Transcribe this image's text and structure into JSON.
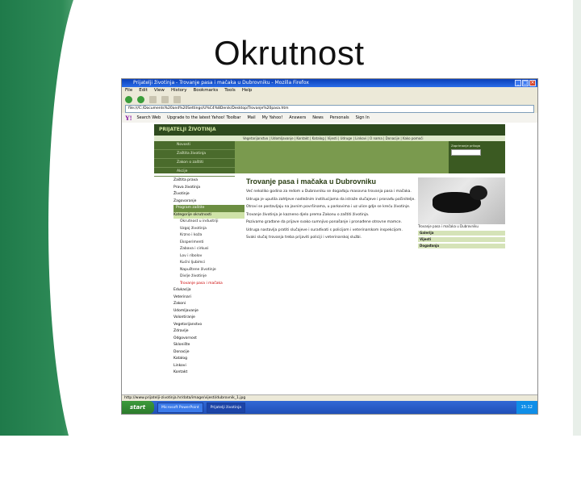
{
  "slide": {
    "title": "Okrutnost"
  },
  "browser": {
    "window_title": "Prijatelji životinja - Trovanje pasa i mačaka u Dubrovniku - Mozilla Firefox",
    "menu": [
      "File",
      "Edit",
      "View",
      "History",
      "Bookmarks",
      "Tools",
      "Help"
    ],
    "address": "file:///C:/Documents%20and%20Settings/U%C4%8Denik/Desktop/Trovanje%20pasa.htm",
    "toolbar_items": [
      "Search Web",
      "Upgrade to the latest Yahoo! Toolbar",
      "Mail",
      "My Yahoo!",
      "Answers",
      "News",
      "Personals",
      "Sign In"
    ],
    "status": "http://www.prijatelji-zivotinja.hr/data/image/vijesti/dubrovnik_1.jpg",
    "taskbar_start": "start",
    "tasks": [
      "Microsoft PowerPoint",
      "Prijatelji životinja"
    ],
    "clock": "15:12"
  },
  "site": {
    "logo": "PRIJATELJI ŽIVOTINJA",
    "nav": "Vegetarijanstvo | Udomljavanje | Kontakt | Katalog | Vijesti | Udruge | Linkovi | O nama | Donacije | Kako pomoći",
    "hero_menu": [
      "Novosti",
      "Zaštita životinja",
      "Zakon o zaštiti",
      "Akcije"
    ],
    "hero_right": "Zaprimanje priloga",
    "sidebar": [
      {
        "t": "Zaštita prava",
        "k": "plain"
      },
      {
        "t": "Prava životinja",
        "k": "plain"
      },
      {
        "t": "Životinje",
        "k": "plain"
      },
      {
        "t": "Zagovaranje",
        "k": "plain"
      },
      {
        "t": "Program zaštite",
        "k": "hdr"
      },
      {
        "t": "Kategorije okrutnosti",
        "k": "hl"
      },
      {
        "t": "Okrutnost u industriji",
        "k": "sub"
      },
      {
        "t": "Uzgoj životinja",
        "k": "sub"
      },
      {
        "t": "Krzno i koža",
        "k": "sub"
      },
      {
        "t": "Eksperimenti",
        "k": "sub"
      },
      {
        "t": "Zabava i cirkusi",
        "k": "sub"
      },
      {
        "t": "Lov i ribolov",
        "k": "sub"
      },
      {
        "t": "Kućni ljubimci",
        "k": "sub"
      },
      {
        "t": "Napuštene životinje",
        "k": "sub"
      },
      {
        "t": "Divlje životinje",
        "k": "sub"
      },
      {
        "t": "Trovanje pasa i mačaka",
        "k": "sub active"
      },
      {
        "t": "Edukacija",
        "k": "plain"
      },
      {
        "t": "Veterinari",
        "k": "plain"
      },
      {
        "t": "Zakoni",
        "k": "plain"
      },
      {
        "t": "Udomljavanje",
        "k": "plain"
      },
      {
        "t": "Volontiranje",
        "k": "plain"
      },
      {
        "t": "Vegetarijanstvo",
        "k": "plain"
      },
      {
        "t": "Zdravlje",
        "k": "plain"
      },
      {
        "t": "Odgovornost",
        "k": "plain"
      },
      {
        "t": "Sklonište",
        "k": "plain"
      },
      {
        "t": "Donacije",
        "k": "plain"
      },
      {
        "t": "Katalog",
        "k": "plain"
      },
      {
        "t": "Linkovi",
        "k": "plain"
      },
      {
        "t": "Kontakt",
        "k": "plain"
      }
    ],
    "article_title": "Trovanje pasa i mačaka u Dubrovniku",
    "paragraphs": [
      "Već nekoliko godina za redom u Dubrovniku se događaju masovna trovanja pasa i mačaka.",
      "Udruga je uputila zahtjeve nadležnim institucijama da istraže slučajeve i pronađu počinitelje.",
      "Otrovi se postavljaju na javnim površinama, u parkovima i uz ulice gdje se kreću životinje.",
      "Trovanje životinja je kazneno djelo prema Zakonu o zaštiti životinja.",
      "Pozivamo građane da prijave svako sumnjivo ponašanje i pronađene otrovne mamce.",
      "Udruga nastavlja pratiti slučajeve i surađivati s policijom i veterinarskom inspekcijom.",
      "Svaki slučaj trovanja treba prijaviti policiji i veterinarskoj službi."
    ],
    "right_caption": "Trovanje pasa i mačaka u Dubrovniku",
    "right_labels": [
      "Galerija",
      "Vijesti",
      "Događanja"
    ]
  }
}
